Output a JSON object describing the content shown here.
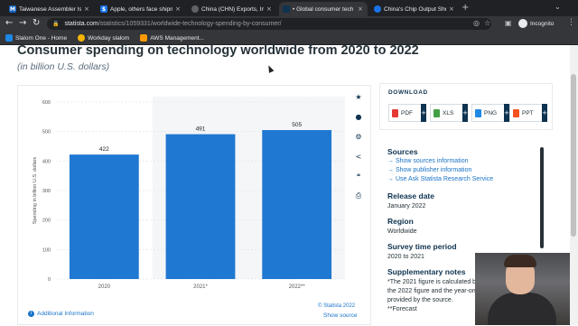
{
  "browser": {
    "tabs": [
      {
        "label": "Taiwanese Assembler Is P",
        "favicon_color": "#1565c0",
        "favicon_char": "M",
        "active": false
      },
      {
        "label": "Apple, others face shipme",
        "favicon_color": "#1a73e8",
        "favicon_char": "$",
        "active": false
      },
      {
        "label": "China (CHN) Exports, Imp",
        "favicon_color": "#5f6368",
        "favicon_char": "",
        "active": false
      },
      {
        "label": "• Global consumer tech s",
        "favicon_color": "#0e3350",
        "favicon_char": "",
        "active": true
      },
      {
        "label": "China's Chip Output Shri",
        "favicon_color": "#1a73e8",
        "favicon_char": "",
        "active": false
      }
    ],
    "new_tab": "+",
    "url_host": "statista.com",
    "url_path": "/statistics/1059331/worldwide-technology-spending-by-consumer/",
    "profile": "Incognito",
    "bookmarks": [
      {
        "label": "Slalom One - Home",
        "color": "#1e88e5"
      },
      {
        "label": "Workday slalom",
        "color": "#f4b400"
      },
      {
        "label": "AWS Management...",
        "color": "#ff9900"
      }
    ]
  },
  "page": {
    "title": "Consumer spending on technology worldwide from 2020 to 2022",
    "subtitle": "(in billion U.S. dollars)",
    "credit": "© Statista 2022",
    "show_source": "Show source",
    "additional_info": "Additional Information"
  },
  "chart_data": {
    "type": "bar",
    "categories": [
      "2020",
      "2021*",
      "2022**"
    ],
    "values": [
      422,
      491,
      505
    ],
    "ylabel": "Spending in billion U.S. dollars",
    "ylim": [
      0,
      600
    ],
    "yticks": [
      0,
      100,
      200,
      300,
      400,
      500,
      600
    ],
    "color": "#1f78d1",
    "grid": true
  },
  "download": {
    "title": "DOWNLOAD",
    "formats": [
      {
        "label": "PDF",
        "color": "#e53935"
      },
      {
        "label": "XLS",
        "color": "#43a047"
      },
      {
        "label": "PNG",
        "color": "#1e88e5"
      },
      {
        "label": "PPT",
        "color": "#f4511e"
      }
    ]
  },
  "info": {
    "sources_head": "Sources",
    "sources_links": [
      "Show sources information",
      "Show publisher information",
      "Use Ask Statista Research Service"
    ],
    "release_head": "Release date",
    "release_val": "January 2022",
    "region_head": "Region",
    "region_val": "Worldwide",
    "period_head": "Survey time period",
    "period_val": "2020 to 2021",
    "notes_head": "Supplementary notes",
    "notes": [
      "*The 2021 figure is calculated by",
      "the 2022 figure and the year-on",
      "provided by the source.",
      "**Forecast"
    ]
  }
}
